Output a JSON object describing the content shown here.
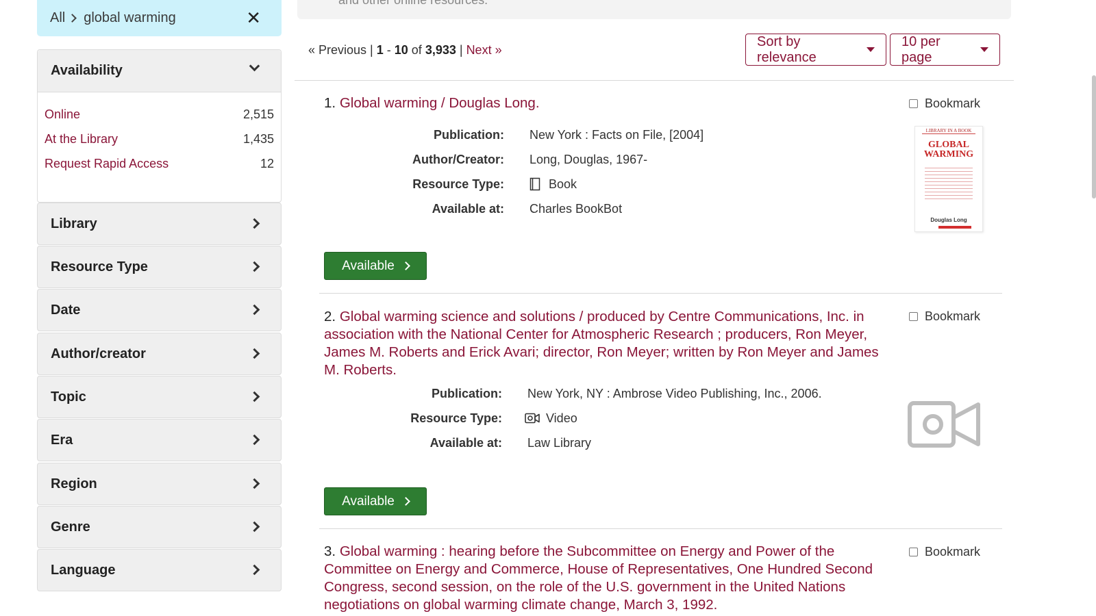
{
  "breadcrumb": {
    "root": "All",
    "query": "global warming"
  },
  "top_banner": {
    "text": "and other online resources."
  },
  "sidebar": {
    "availability": {
      "label": "Availability",
      "options": [
        {
          "label": "Online",
          "count": "2,515"
        },
        {
          "label": "At the Library",
          "count": "1,435"
        },
        {
          "label": "Request Rapid Access",
          "count": "12"
        }
      ]
    },
    "facets": [
      "Library",
      "Resource Type",
      "Date",
      "Author/creator",
      "Topic",
      "Era",
      "Region",
      "Genre",
      "Language"
    ]
  },
  "pager": {
    "previous": "« Previous",
    "range_start": "1",
    "range_end": "10",
    "total": "3,933",
    "next": "Next »",
    "of": "of"
  },
  "sort": {
    "label": "Sort by relevance"
  },
  "per_page": {
    "label": "10 per page"
  },
  "results": [
    {
      "number": "1.",
      "title": "Global warming / Douglas Long.",
      "bookmark": "Bookmark",
      "fields": [
        {
          "label": "Publication:",
          "value": "New York : Facts on File, [2004]"
        },
        {
          "label": "Author/Creator:",
          "value": "Long, Douglas, 1967-"
        },
        {
          "label": "Resource Type:",
          "value": "Book",
          "icon": "book-icon"
        },
        {
          "label": "Available at:",
          "value": "Charles BookBot"
        }
      ],
      "button": "Available",
      "cover": {
        "series": "LIBRARY IN A BOOK",
        "title": "GLOBAL WARMING",
        "author": "Douglas Long"
      }
    },
    {
      "number": "2.",
      "title": "Global warming science and solutions / produced by Centre Communications, Inc. in association with the National Center for Atmospheric Research ; producers, Ron Meyer, James M. Roberts and Erick Avari; director, Ron Meyer; written by Ron Meyer and James M. Roberts.",
      "bookmark": "Bookmark",
      "fields": [
        {
          "label": "Publication:",
          "value": "New York, NY : Ambrose Video Publishing, Inc., 2006."
        },
        {
          "label": "Resource Type:",
          "value": "Video",
          "icon": "video-icon"
        },
        {
          "label": "Available at:",
          "value": "Law Library"
        }
      ],
      "button": "Available"
    },
    {
      "number": "3.",
      "title": "Global warming : hearing before the Subcommittee on Energy and Power of the Committee on Energy and Commerce, House of Representatives, One Hundred Second Congress, second session, on the role of the U.S. government in the United Nations negotiations on global warming climate change, March 3, 1992.",
      "bookmark": "Bookmark"
    }
  ],
  "colors": {
    "link": "#8a1538",
    "button": "#2e7d32",
    "breadcrumb_bg": "#cdf2fb",
    "facet_bg": "#efefef"
  }
}
